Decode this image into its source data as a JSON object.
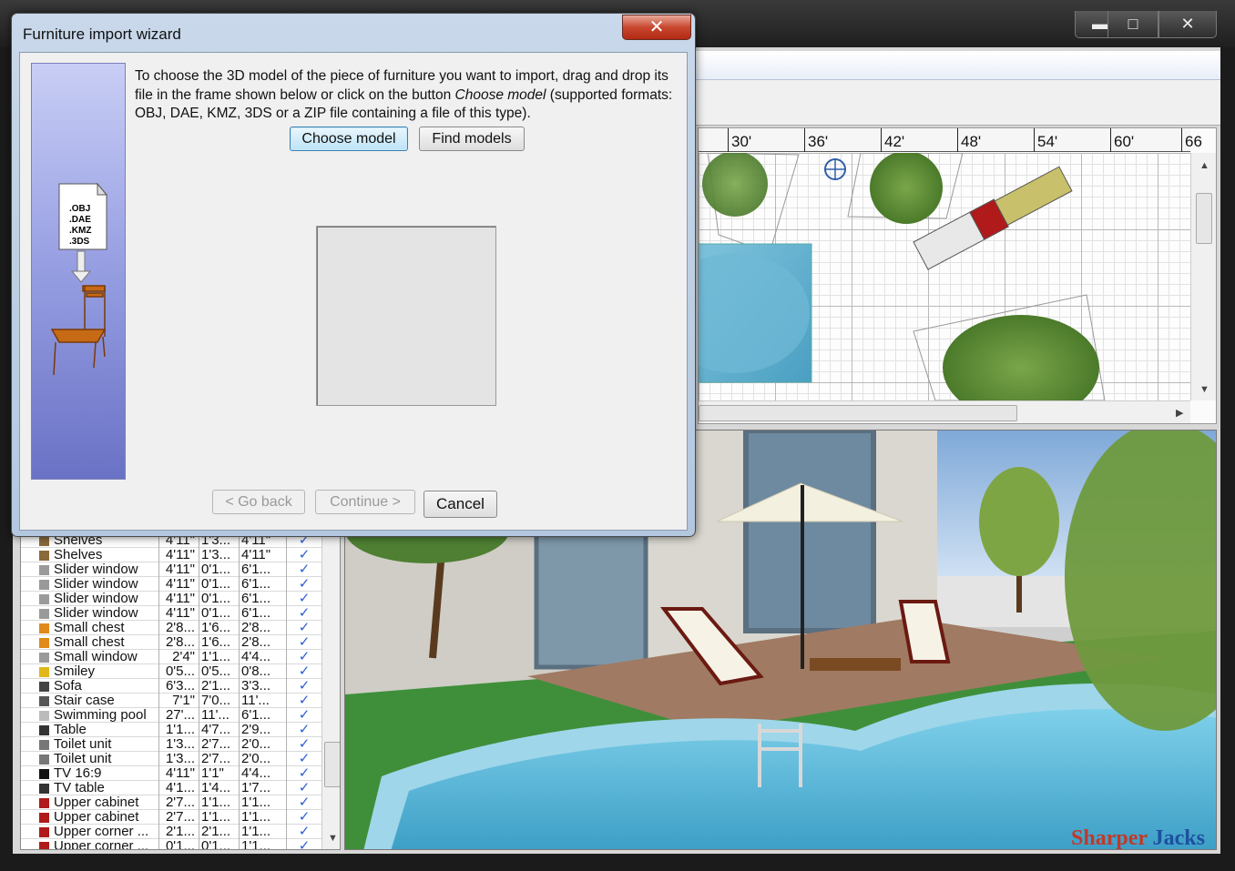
{
  "dialog": {
    "title": "Furniture import wizard",
    "instructions_1": "To choose the 3D model of the piece of furniture you want to import, drag and drop its file in the frame shown below or click on the button ",
    "instructions_em": "Choose model",
    "instructions_2": " (supported formats: OBJ, DAE, KMZ, 3DS or a ZIP file containing a file of this type).",
    "choose_model_label": "Choose model",
    "find_models_label": "Find models",
    "go_back_label": "< Go back",
    "continue_label": "Continue >",
    "cancel_label": "Cancel",
    "close_glyph": "✕",
    "file_formats": [
      ".OBJ",
      ".DAE",
      ".KMZ",
      ".3DS"
    ]
  },
  "window": {
    "minimize_glyph": "▬",
    "maximize_glyph": "□",
    "close_glyph": "✕"
  },
  "plan": {
    "ruler_labels": [
      "30'",
      "36'",
      "42'",
      "48'",
      "54'",
      "60'",
      "66"
    ]
  },
  "furniture_list": {
    "rows": [
      {
        "name": "Shelves",
        "width": "4'11\"",
        "depth": "1'3...",
        "height": "4'11\"",
        "visible": "✓",
        "color": "#8a6a3a"
      },
      {
        "name": "Shelves",
        "width": "4'11\"",
        "depth": "1'3...",
        "height": "4'11\"",
        "visible": "✓",
        "color": "#8a6a3a"
      },
      {
        "name": "Slider window",
        "width": "4'11\"",
        "depth": "0'1...",
        "height": "6'1...",
        "visible": "✓",
        "color": "#9a9a9a"
      },
      {
        "name": "Slider window",
        "width": "4'11\"",
        "depth": "0'1...",
        "height": "6'1...",
        "visible": "✓",
        "color": "#9a9a9a"
      },
      {
        "name": "Slider window",
        "width": "4'11\"",
        "depth": "0'1...",
        "height": "6'1...",
        "visible": "✓",
        "color": "#9a9a9a"
      },
      {
        "name": "Slider window",
        "width": "4'11\"",
        "depth": "0'1...",
        "height": "6'1...",
        "visible": "✓",
        "color": "#9a9a9a"
      },
      {
        "name": "Small chest",
        "width": "2'8...",
        "depth": "1'6...",
        "height": "2'8...",
        "visible": "✓",
        "color": "#e08a1a"
      },
      {
        "name": "Small chest",
        "width": "2'8...",
        "depth": "1'6...",
        "height": "2'8...",
        "visible": "✓",
        "color": "#e08a1a"
      },
      {
        "name": "Small window",
        "width": "2'4\"",
        "depth": "1'1...",
        "height": "4'4...",
        "visible": "✓",
        "color": "#9a9a9a"
      },
      {
        "name": "Smiley",
        "width": "0'5...",
        "depth": "0'5...",
        "height": "0'8...",
        "visible": "✓",
        "color": "#e0b81a"
      },
      {
        "name": "Sofa",
        "width": "6'3...",
        "depth": "2'1...",
        "height": "3'3...",
        "visible": "✓",
        "color": "#444444"
      },
      {
        "name": "Stair case",
        "width": "7'1\"",
        "depth": "7'0...",
        "height": "11'...",
        "visible": "✓",
        "color": "#555555"
      },
      {
        "name": "Swimming pool",
        "width": "27'...",
        "depth": "11'...",
        "height": "6'1...",
        "visible": "✓",
        "color": "#bbbbbb"
      },
      {
        "name": "Table",
        "width": "1'1...",
        "depth": "4'7...",
        "height": "2'9...",
        "visible": "✓",
        "color": "#333333"
      },
      {
        "name": "Toilet unit",
        "width": "1'3...",
        "depth": "2'7...",
        "height": "2'0...",
        "visible": "✓",
        "color": "#777777"
      },
      {
        "name": "Toilet unit",
        "width": "1'3...",
        "depth": "2'7...",
        "height": "2'0...",
        "visible": "✓",
        "color": "#777777"
      },
      {
        "name": "TV 16:9",
        "width": "4'11\"",
        "depth": "1'1\"",
        "height": "4'4...",
        "visible": "✓",
        "color": "#111111"
      },
      {
        "name": "TV table",
        "width": "4'1...",
        "depth": "1'4...",
        "height": "1'7...",
        "visible": "✓",
        "color": "#333333"
      },
      {
        "name": "Upper cabinet",
        "width": "2'7...",
        "depth": "1'1...",
        "height": "1'1...",
        "visible": "✓",
        "color": "#b01a1a"
      },
      {
        "name": "Upper cabinet",
        "width": "2'7...",
        "depth": "1'1...",
        "height": "1'1...",
        "visible": "✓",
        "color": "#b01a1a"
      },
      {
        "name": "Upper corner ...",
        "width": "2'1...",
        "depth": "2'1...",
        "height": "1'1...",
        "visible": "✓",
        "color": "#b01a1a"
      },
      {
        "name": "Upper corner ...",
        "width": "0'1...",
        "depth": "0'1...",
        "height": "1'1...",
        "visible": "✓",
        "color": "#b01a1a"
      }
    ]
  },
  "watermark": {
    "part1": "Sharper",
    "part2": "Jacks"
  }
}
